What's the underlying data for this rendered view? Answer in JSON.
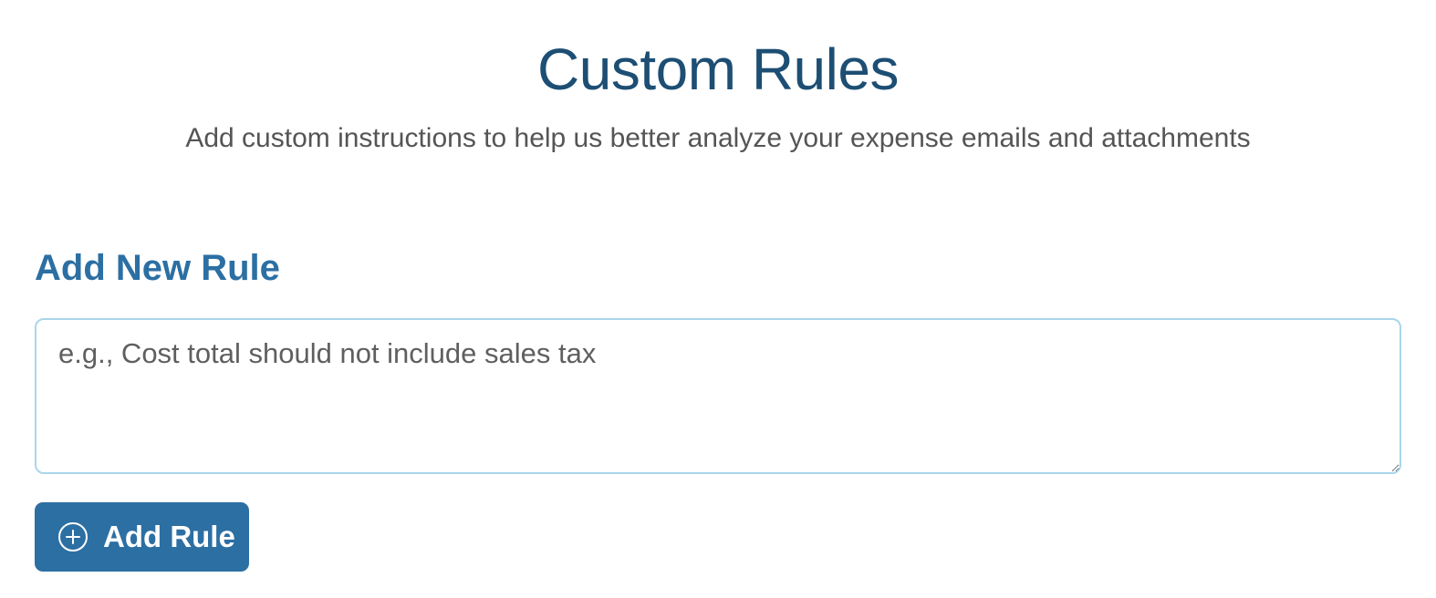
{
  "header": {
    "title": "Custom Rules",
    "subtitle": "Add custom instructions to help us better analyze your expense emails and attachments"
  },
  "add_rule_section": {
    "heading": "Add New Rule",
    "textarea": {
      "value": "",
      "placeholder": "e.g., Cost total should not include sales tax"
    },
    "button": {
      "label": "Add Rule",
      "icon": "plus-circle-icon"
    }
  },
  "colors": {
    "title": "#1d4e74",
    "heading": "#2c6fa3",
    "button_bg": "#2c6fa3",
    "textarea_border": "#a9d6ea",
    "subtitle": "#555555"
  }
}
